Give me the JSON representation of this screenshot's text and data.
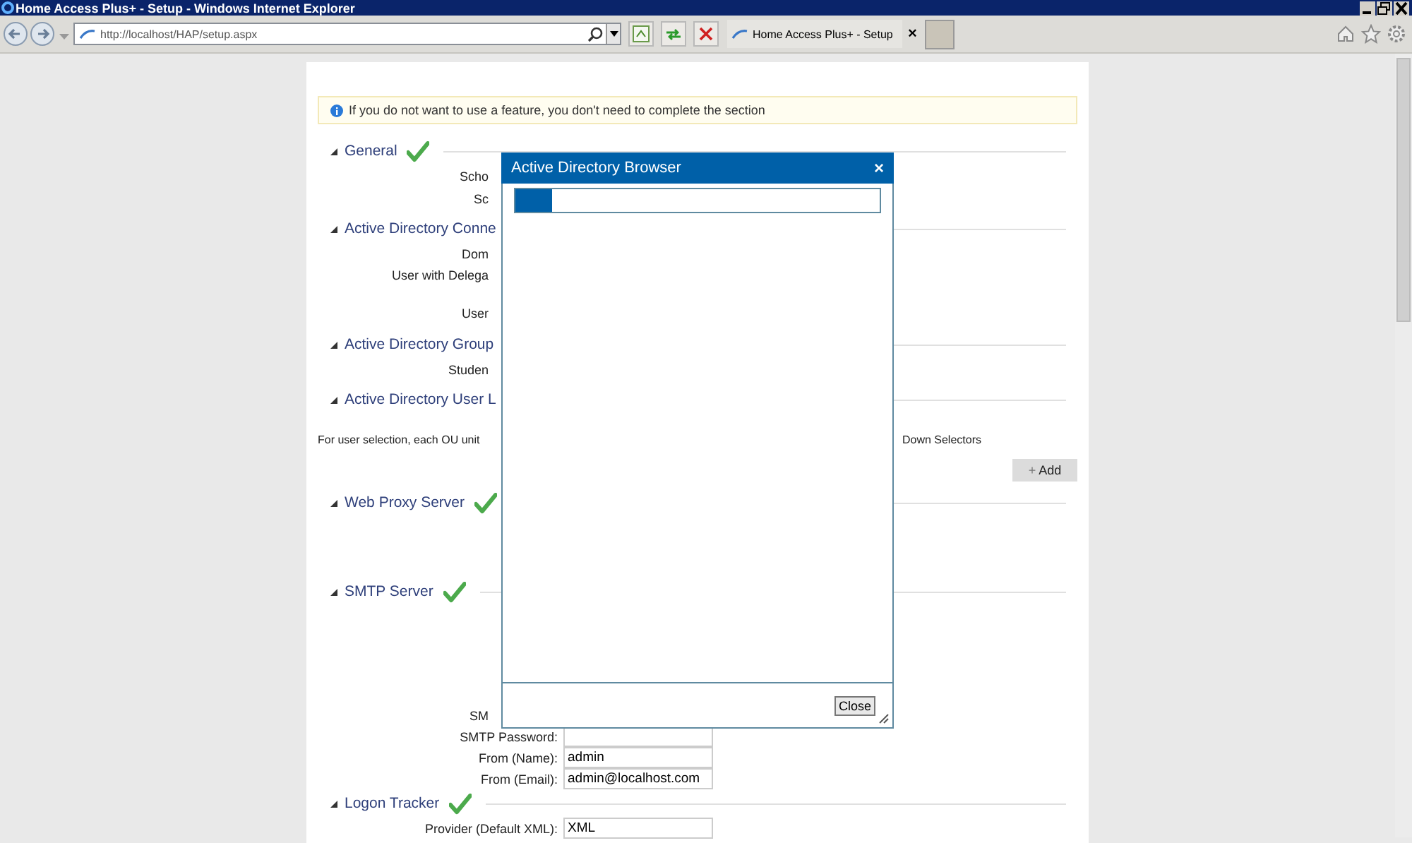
{
  "window": {
    "title": "Home Access Plus+ - Setup - Windows Internet Explorer"
  },
  "address_bar": {
    "value": "http://localhost/HAP/setup.aspx"
  },
  "tabs": [
    {
      "label": "Home Access Plus+ - Setup"
    }
  ],
  "tab_close": "×",
  "info": "If you do not want to use a feature, you don't need to complete the section",
  "sections": [
    {
      "title": "General",
      "complete": true,
      "rows": [
        {
          "label": "Scho"
        },
        {
          "label": "Sc"
        }
      ]
    },
    {
      "title": "Active Directory Conne",
      "rows": [
        {
          "label": "Dom"
        },
        {
          "label": "User with Delega"
        },
        {
          "label": "User"
        }
      ]
    },
    {
      "title": "Active Directory Group",
      "rows": [
        {
          "label": "Studen"
        }
      ]
    },
    {
      "title": "Active Directory User L",
      "note": "For user selection, each OU unit",
      "note_tail": "Down Selectors",
      "button": "Add",
      "button_icon": "+"
    },
    {
      "title": "Web Proxy Server",
      "complete": true
    },
    {
      "title": "SMTP Server",
      "complete": true,
      "rows": [
        {
          "label": "SM"
        },
        {
          "label": "SMTP Password:",
          "value": ""
        },
        {
          "label": "From (Name):",
          "value": "admin"
        },
        {
          "label": "From (Email):",
          "value": "admin@localhost.com"
        }
      ]
    },
    {
      "title": "Logon Tracker",
      "complete": true,
      "rows": [
        {
          "label": "Provider (Default XML):",
          "value": "XML"
        }
      ]
    }
  ],
  "dialog": {
    "title": "Active Directory Browser",
    "close_icon": "×",
    "progress": {
      "level": 0.1
    },
    "button": "Close"
  }
}
